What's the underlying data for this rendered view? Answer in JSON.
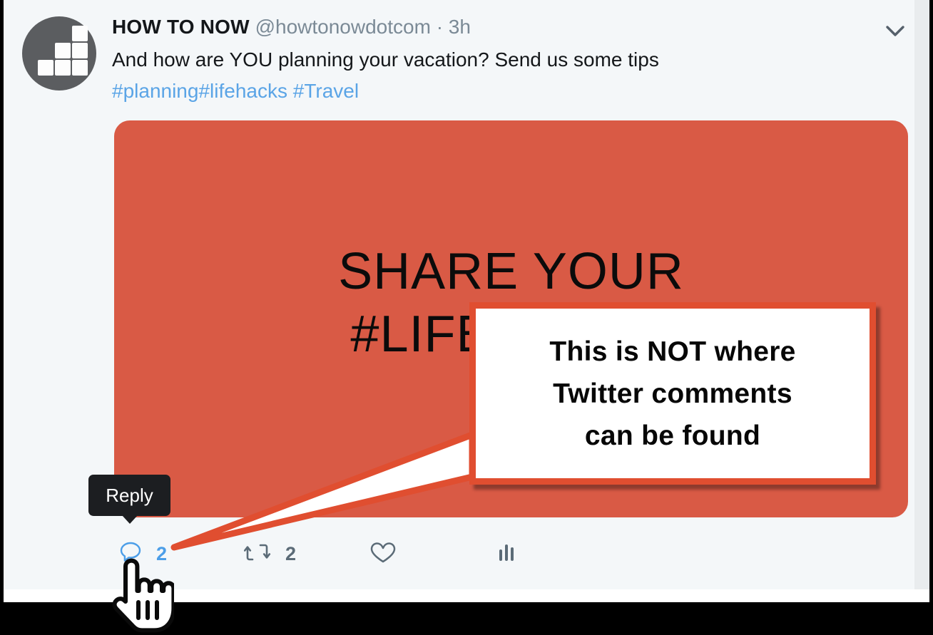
{
  "tweet": {
    "display_name": "HOW TO NOW",
    "handle": "@howtonowdotcom",
    "separator": "·",
    "timestamp": "3h",
    "body_plain": "And how are YOU planning your vacation? Send us some tips ",
    "hashtag_planning": "#planning",
    "hashtag_lifehacks": "#lifehacks",
    "hashtag_travel": "#Travel",
    "space": " ",
    "more_icon": "chevron-down-icon",
    "avatar_icon": "bar-chart-logo-avatar"
  },
  "media": {
    "line1": "SHARE YOUR",
    "line2": "#LIFEHACKS",
    "background_color": "#D95A45",
    "text_color": "#0B0B0B"
  },
  "actions": {
    "reply": {
      "icon": "reply-bubble-icon",
      "count": "2",
      "color": "#4C9EE8"
    },
    "retweet": {
      "icon": "retweet-icon",
      "count": "2",
      "color": "#5B6B77"
    },
    "like": {
      "icon": "heart-icon",
      "count": "",
      "color": "#5B6B77"
    },
    "analytics": {
      "icon": "analytics-bars-icon",
      "count": "",
      "color": "#5B6B77"
    }
  },
  "tooltip": {
    "label": "Reply"
  },
  "annotation": {
    "line1": "This is NOT where",
    "line2": "Twitter comments",
    "line3": "can be found",
    "accent_color": "#E04E30"
  },
  "cursor": {
    "icon": "pointing-hand-cursor"
  },
  "colors": {
    "page_background": "#F4F7F9",
    "link_blue": "#5AA4E6",
    "muted_text": "#7B8A96",
    "primary_text": "#14171A"
  }
}
